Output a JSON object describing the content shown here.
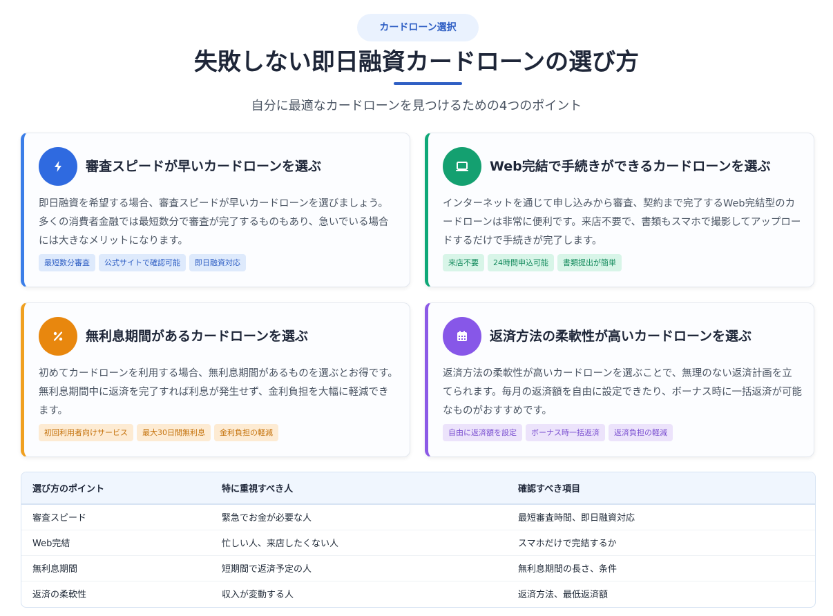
{
  "header": {
    "badge": "カードローン選択",
    "title": "失敗しない即日融資カードローンの選び方",
    "subtitle": "自分に最適なカードローンを見つけるための4つのポイント"
  },
  "cards": [
    {
      "icon": "lightning-icon",
      "title": "審査スピードが早いカードローンを選ぶ",
      "body": "即日融資を希望する場合、審査スピードが早いカードローンを選びましょう。多くの消費者金融では最短数分で審査が完了するものもあり、急いでいる場合には大きなメリットになります。",
      "tags": [
        "最短数分審査",
        "公式サイトで確認可能",
        "即日融資対応"
      ]
    },
    {
      "icon": "laptop-icon",
      "title": "Web完結で手続きができるカードローンを選ぶ",
      "body": "インターネットを通じて申し込みから審査、契約まで完了するWeb完結型のカードローンは非常に便利です。来店不要で、書類もスマホで撮影してアップロードするだけで手続きが完了します。",
      "tags": [
        "来店不要",
        "24時間申込可能",
        "書類提出が簡単"
      ]
    },
    {
      "icon": "percent-icon",
      "title": "無利息期間があるカードローンを選ぶ",
      "body": "初めてカードローンを利用する場合、無利息期間があるものを選ぶとお得です。無利息期間中に返済を完了すれば利息が発生せず、金利負担を大幅に軽減できます。",
      "tags": [
        "初回利用者向けサービス",
        "最大30日間無利息",
        "金利負担の軽減"
      ]
    },
    {
      "icon": "calendar-icon",
      "title": "返済方法の柔軟性が高いカードローンを選ぶ",
      "body": "返済方法の柔軟性が高いカードローンを選ぶことで、無理のない返済計画を立てられます。毎月の返済額を自由に設定できたり、ボーナス時に一括返済が可能なものがおすすめです。",
      "tags": [
        "自由に返済額を設定",
        "ボーナス時一括返済",
        "返済負担の軽減"
      ]
    }
  ],
  "table": {
    "headers": [
      "選び方のポイント",
      "特に重視すべき人",
      "確認すべき項目"
    ],
    "rows": [
      [
        "審査スピード",
        "緊急でお金が必要な人",
        "最短審査時間、即日融資対応"
      ],
      [
        "Web完結",
        "忙しい人、来店したくない人",
        "スマホだけで完結するか"
      ],
      [
        "無利息期間",
        "短期間で返済予定の人",
        "無利息期間の長さ、条件"
      ],
      [
        "返済の柔軟性",
        "収入が変動する人",
        "返済方法、最低返済額"
      ]
    ]
  }
}
